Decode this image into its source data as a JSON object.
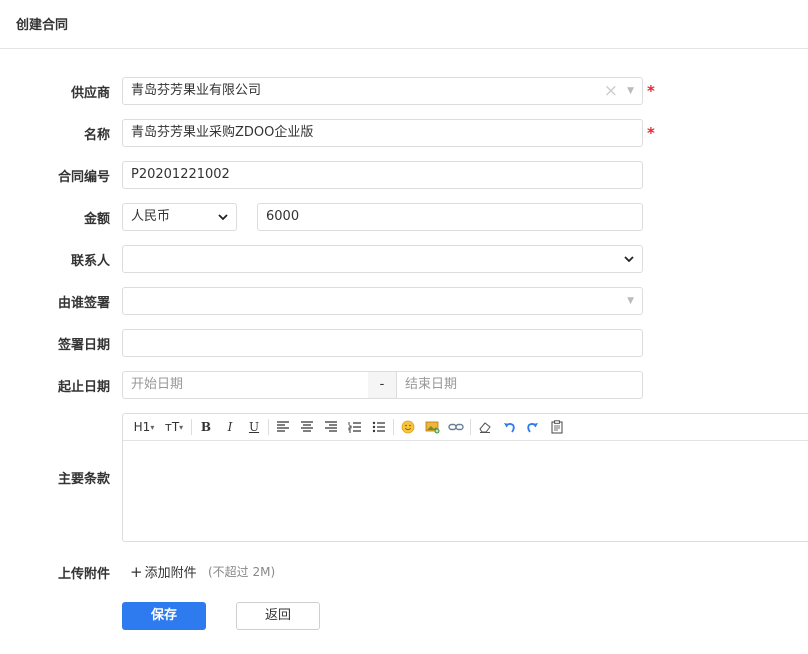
{
  "page": {
    "title": "创建合同"
  },
  "form": {
    "supplier": {
      "label": "供应商",
      "value": "青岛芬芳果业有限公司",
      "required_mark": "*"
    },
    "name": {
      "label": "名称",
      "value": "青岛芬芳果业采购ZDOO企业版",
      "required_mark": "*"
    },
    "contract_no": {
      "label": "合同编号",
      "value": "P20201221002"
    },
    "amount": {
      "label": "金额",
      "currency": "人民币",
      "value": "6000"
    },
    "contact": {
      "label": "联系人",
      "value": ""
    },
    "signed_by": {
      "label": "由谁签署",
      "value": ""
    },
    "sign_date": {
      "label": "签署日期",
      "value": ""
    },
    "date_range": {
      "label": "起止日期",
      "start_placeholder": "开始日期",
      "separator": "-",
      "end_placeholder": "结束日期"
    },
    "terms": {
      "label": "主要条款",
      "toolbar": {
        "heading": "H1",
        "font_size": "тT",
        "bold": "B",
        "italic": "I",
        "underline": "U"
      }
    },
    "attachment": {
      "label": "上传附件",
      "add_label": "添加附件",
      "add_icon": "plus-icon",
      "hint": "(不超过 2M)"
    }
  },
  "actions": {
    "save": "保存",
    "back": "返回"
  },
  "colors": {
    "primary": "#2e7bf0",
    "required": "#e23333"
  }
}
